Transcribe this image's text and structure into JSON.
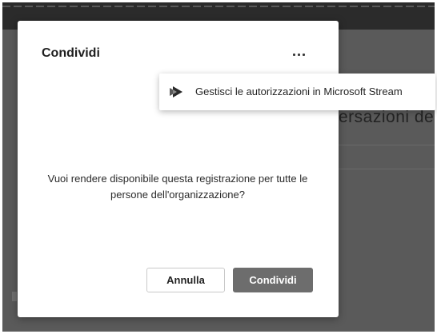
{
  "background": {
    "partial_heading": "ersazioni de"
  },
  "dialog": {
    "title": "Condividi",
    "more_options_icon": "ellipsis-icon",
    "message": "Vuoi rendere disponibile questa registrazione per tutte le persone dell'organizzazione?",
    "cancel_label": "Annulla",
    "confirm_label": "Condividi"
  },
  "popup_menu": {
    "items": [
      {
        "icon": "microsoft-stream-icon",
        "label": "Gestisci le autorizzazioni in Microsoft Stream"
      }
    ]
  },
  "colors": {
    "overlay": "#5a5a5a",
    "primary_button": "#6d6d6d",
    "dialog_bg": "#ffffff"
  }
}
